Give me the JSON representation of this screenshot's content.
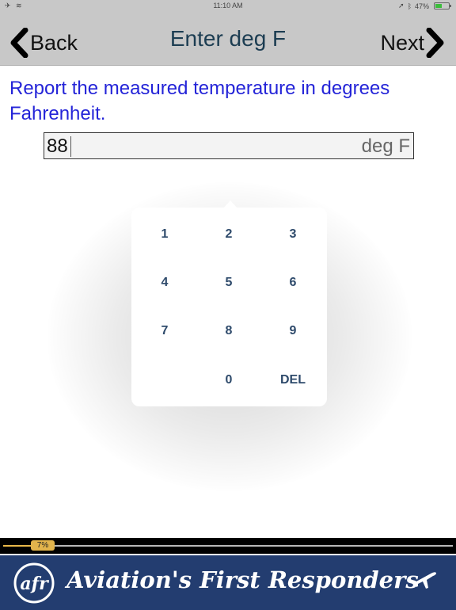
{
  "status_bar": {
    "time": "11:10 AM",
    "battery_percent": "47%",
    "battery_level": 0.47
  },
  "nav": {
    "back_label": "Back",
    "title": "Enter deg F",
    "next_label": "Next"
  },
  "prompt": "Report the measured temperature in degrees Fahrenheit.",
  "input": {
    "value": "88",
    "unit": "deg F"
  },
  "keypad": {
    "keys": [
      "1",
      "2",
      "3",
      "4",
      "5",
      "6",
      "7",
      "8",
      "9",
      "0",
      "DEL"
    ]
  },
  "progress": {
    "label": "7%",
    "value": 0.07
  },
  "banner": {
    "logo_text": "afr",
    "text": "Aviation's First Responders"
  },
  "colors": {
    "prompt": "#2424d8",
    "title": "#1c3d52",
    "keypad_text": "#2e4a6b",
    "banner_bg": "#233d70",
    "progress": "#e2b44c"
  }
}
